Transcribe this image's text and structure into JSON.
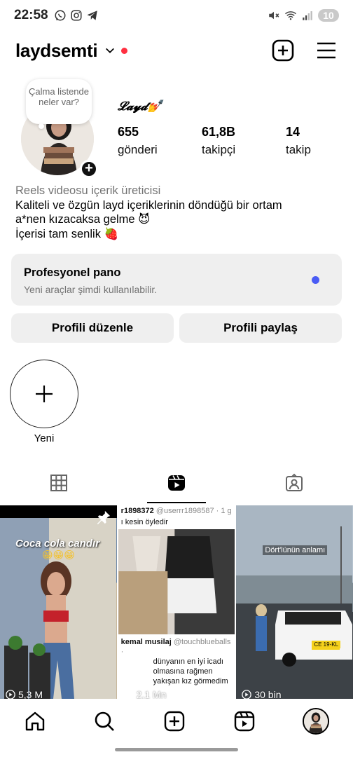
{
  "status": {
    "time": "22:58",
    "battery": "10",
    "left_icons": [
      "whatsapp-icon",
      "instagram-icon",
      "telegram-icon"
    ],
    "right_icons": [
      "mute-icon",
      "wifi-icon",
      "signal-icon"
    ]
  },
  "header": {
    "username": "laydsemti",
    "icons": [
      "chevron-down-icon",
      "add-post-icon",
      "menu-icon"
    ]
  },
  "profile": {
    "note": "Çalma listende neler var?",
    "display_name": "𝓛𝓪𝔂𝓭💅",
    "stats": [
      {
        "value": "655",
        "label": "gönderi"
      },
      {
        "value": "61,8B",
        "label": "takipçi"
      },
      {
        "value": "14",
        "label": "takip"
      }
    ],
    "category": "Reels videosu içerik üreticisi",
    "bio_lines": [
      "Kaliteli ve özgün layd içeriklerinin döndüğü bir ortam",
      "a*nen kızacaksa gelme 😈",
      "İçerisi tam senlik 🍓"
    ]
  },
  "dashboard": {
    "title": "Profesyonel pano",
    "subtitle": "Yeni araçlar şimdi kullanılabilir.",
    "dot_color": "#4a5cf5"
  },
  "buttons": {
    "edit": "Profili düzenle",
    "share": "Profili paylaş"
  },
  "highlight": {
    "label": "Yeni"
  },
  "tabs": [
    "grid-icon",
    "reels-icon",
    "tagged-icon"
  ],
  "reels": [
    {
      "caption": "Coca cola candır",
      "emoji": "😁😁😁",
      "views": "5,3 M"
    },
    {
      "header_user": "r1898372",
      "header_handle": "@userrr1898587 · 1 g",
      "header_text": "ı kesin öyledir",
      "quote_user": "kemal musilaj",
      "quote_handle": "@touchblueballs ·",
      "quote_text": "dünyanın en iyi icadı olmasına rağmen yakışan kız görmedim",
      "views": "2,1 Mn"
    },
    {
      "caption": "Dört'lünün anlamı",
      "plate": "CE 19-KL",
      "views": "30 bin"
    }
  ],
  "bottom_nav": [
    "home-icon",
    "search-icon",
    "create-icon",
    "reels-nav-icon",
    "profile-avatar"
  ]
}
